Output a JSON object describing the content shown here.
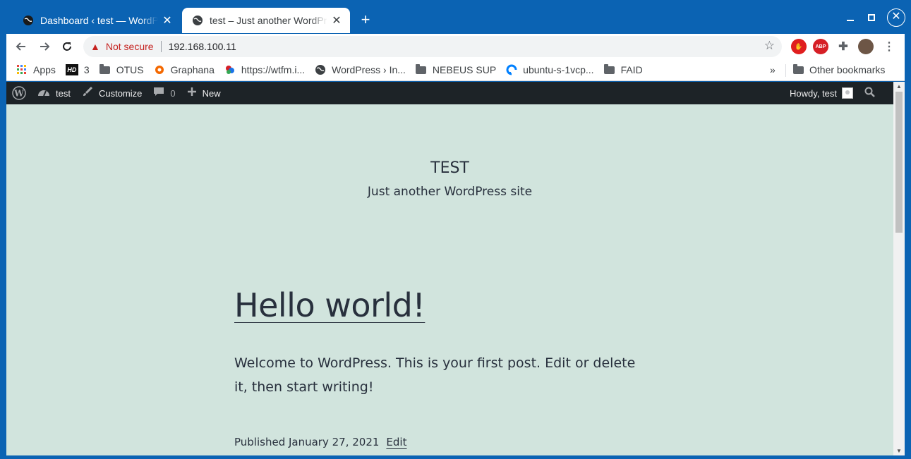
{
  "tabs": [
    {
      "title": "Dashboard ‹ test — WordPress",
      "active": false
    },
    {
      "title": "test – Just another WordPress site",
      "active": true
    }
  ],
  "omnibox": {
    "security_label": "Not secure",
    "url": "192.168.100.11"
  },
  "bookmarks": [
    {
      "label": "Apps",
      "icon": "apps-grid-icon"
    },
    {
      "label": "3",
      "icon": "hd-icon"
    },
    {
      "label": "OTUS",
      "icon": "folder-icon"
    },
    {
      "label": "Graphana",
      "icon": "grafana-icon"
    },
    {
      "label": "https://wtfm.i...",
      "icon": "site-icon"
    },
    {
      "label": "WordPress › In...",
      "icon": "globe-icon"
    },
    {
      "label": "NEBEUS SUP",
      "icon": "folder-icon"
    },
    {
      "label": "ubuntu-s-1vcp...",
      "icon": "digitalocean-icon"
    },
    {
      "label": "FAID",
      "icon": "folder-icon"
    }
  ],
  "other_bookmarks": "Other bookmarks",
  "adminbar": {
    "site": "test",
    "customize": "Customize",
    "comments_count": "0",
    "new": "New",
    "howdy": "Howdy, test"
  },
  "site": {
    "title": "TEST",
    "description": "Just another WordPress site"
  },
  "post": {
    "title": "Hello world!",
    "body": "Welcome to WordPress. This is your first post. Edit or delete it, then start writing!",
    "published": "Published January 27, 2021",
    "edit": "Edit"
  },
  "colors": {
    "chrome_frame": "#0b63b3",
    "page_background": "#d1e4dd",
    "adminbar": "#1d2327",
    "text": "#28303d"
  }
}
